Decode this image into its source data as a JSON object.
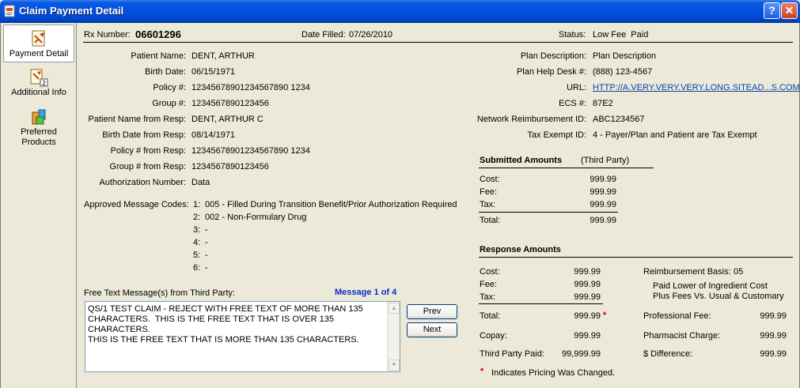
{
  "window": {
    "title": "Claim Payment Detail",
    "help_label": "?",
    "close_label": "✕"
  },
  "sidebar": {
    "items": [
      {
        "label": "Payment Detail",
        "icon": "payment-detail-icon"
      },
      {
        "label": "Additional Info",
        "icon": "additional-info-icon"
      },
      {
        "label": "Preferred Products",
        "icon": "preferred-products-icon"
      }
    ]
  },
  "header": {
    "rx_label": "Rx Number:",
    "rx_value": "06601296",
    "date_filled_label": "Date Filled:",
    "date_filled_value": "07/26/2010",
    "status_label": "Status:",
    "status_value": "Low Fee  Paid"
  },
  "patient": [
    {
      "label": "Patient Name:",
      "value": "DENT, ARTHUR"
    },
    {
      "label": "Birth Date:",
      "value": "06/15/1971"
    },
    {
      "label": "Policy #:",
      "value": "12345678901234567890 1234"
    },
    {
      "label": "Group #:",
      "value": "1234567890123456"
    },
    {
      "label": "Patient Name from Resp:",
      "value": "DENT, ARTHUR C"
    },
    {
      "label": "Birth Date from Resp:",
      "value": "08/14/1971"
    },
    {
      "label": "Policy # from Resp:",
      "value": "12345678901234567890 1234"
    },
    {
      "label": "Group # from Resp:",
      "value": "1234567890123456"
    },
    {
      "label": "Authorization Number:",
      "value": "Data"
    }
  ],
  "plan": [
    {
      "label": "Plan Description:",
      "value": "Plan Description"
    },
    {
      "label": "Plan Help Desk #:",
      "value": "(888) 123-4567"
    },
    {
      "label": "URL:",
      "value": "HTTP://A.VERY.VERY.VERY.LONG.SITEAD...S.COM"
    },
    {
      "label": "ECS #:",
      "value": "87E2"
    },
    {
      "label": "Network Reimbursement ID:",
      "value": "ABC1234567"
    },
    {
      "label": "Tax Exempt ID:",
      "value": "4 - Payer/Plan and Patient are Tax Exempt"
    }
  ],
  "approved_codes": {
    "label": "Approved Message Codes:",
    "items": [
      {
        "num": "1:",
        "text": "005 - Filled During Transition Benefit/Prior Authorization Required"
      },
      {
        "num": "2:",
        "text": "002 - Non-Formulary Drug"
      },
      {
        "num": "3:",
        "text": "-"
      },
      {
        "num": "4:",
        "text": "-"
      },
      {
        "num": "5:",
        "text": "-"
      },
      {
        "num": "6:",
        "text": "-"
      }
    ]
  },
  "free_text": {
    "label": "Free Text Message(s) from Third Party:",
    "counter": "Message 1 of 4",
    "message": "QS/1 TEST CLAIM - REJECT WITH FREE TEXT OF MORE THAN 135\nCHARACTERS.  THIS IS THE FREE TEXT THAT IS OVER 135 CHARACTERS.\nTHIS IS THE FREE TEXT THAT IS MORE THAN 135 CHARACTERS.",
    "prev_label": "Prev",
    "next_label": "Next"
  },
  "submitted": {
    "title": "Submitted Amounts",
    "subtitle": "(Third Party)",
    "rows": [
      {
        "label": "Cost:",
        "value": "999.99"
      },
      {
        "label": "Fee:",
        "value": "999.99"
      },
      {
        "label": "Tax:",
        "value": "999.99"
      }
    ],
    "total_label": "Total:",
    "total_value": "999.99"
  },
  "response": {
    "title": "Response Amounts",
    "rows": [
      {
        "label": "Cost:",
        "value": "999.99"
      },
      {
        "label": "Fee:",
        "value": "999.99"
      },
      {
        "label": "Tax:",
        "value": "999.99"
      }
    ],
    "total_label": "Total:",
    "total_value": "999.99",
    "total_marker": "*",
    "copay_label": "Copay:",
    "copay_value": "999.99",
    "third_party_label": "Third Party Paid:",
    "third_party_value": "99,999.99",
    "reimb_label": "Reimbursement Basis:",
    "reimb_value": "05",
    "reimb_desc_1": "Paid Lower of Ingredient Cost",
    "reimb_desc_2": "Plus Fees Vs. Usual & Customary",
    "prof_fee_label": "Professional Fee:",
    "prof_fee_value": "999.99",
    "pharm_charge_label": "Pharmacist Charge:",
    "pharm_charge_value": "999.99",
    "diff_label": "$ Difference:",
    "diff_value": "999.99",
    "footnote_marker": "*",
    "footnote_text": "Indicates Pricing Was Changed."
  },
  "colors": {
    "titlebar": "#0054e3",
    "window_bg": "#ece9d8",
    "link": "#0645ad",
    "counter": "#0a2ec8",
    "marker": "#c00000"
  }
}
